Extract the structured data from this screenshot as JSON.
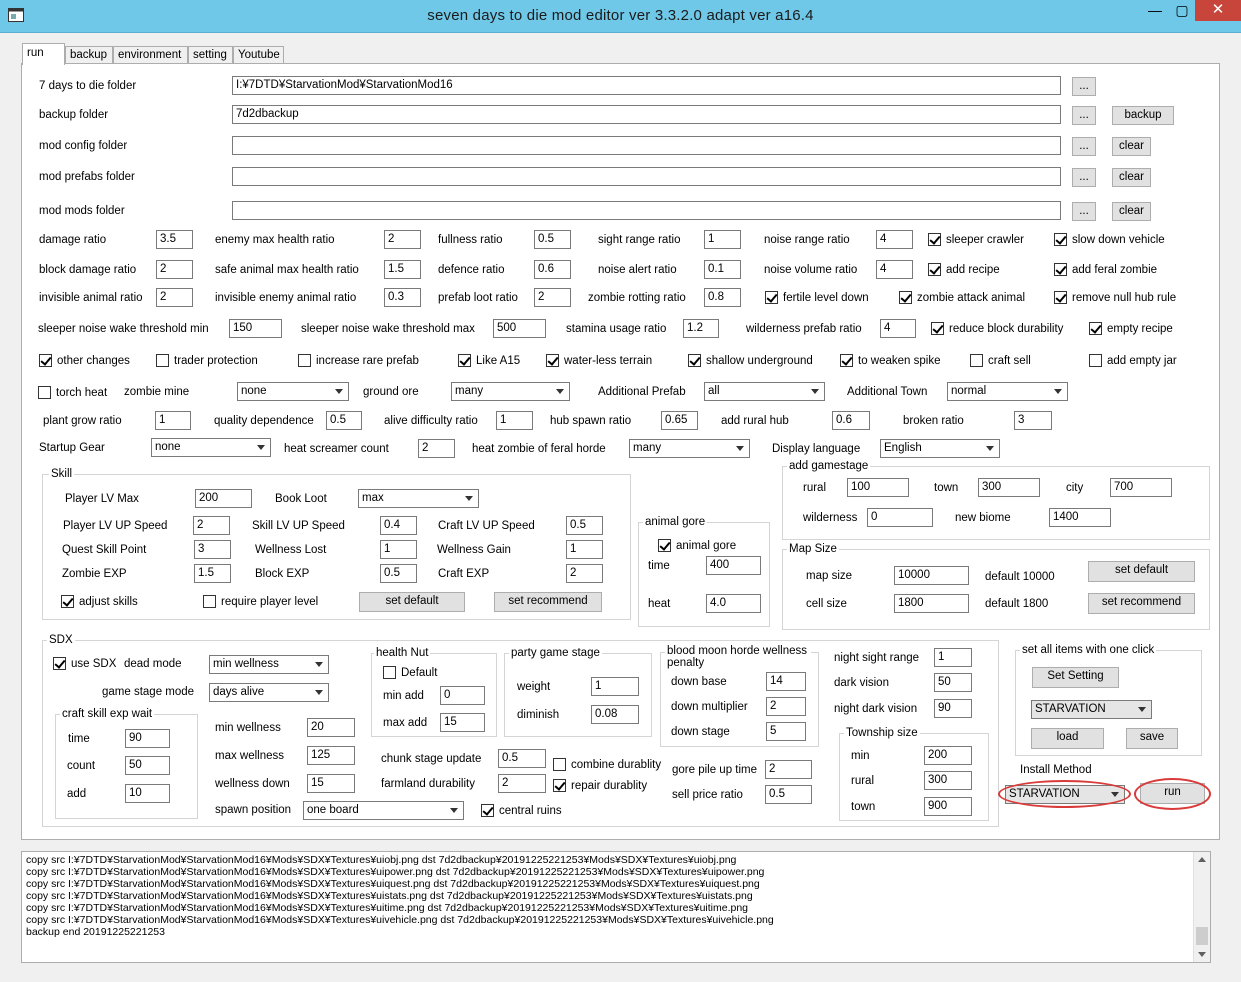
{
  "window": {
    "title": "seven days to die mod editor ver 3.3.2.0 adapt ver a16.4",
    "min": "—",
    "max": "▢",
    "close": "✕"
  },
  "tabs": [
    "run",
    "backup",
    "environment",
    "setting",
    "Youtube"
  ],
  "folders": {
    "seven_days_label": "7 days to die folder",
    "seven_days_value": "I:¥7DTD¥StarvationMod¥StarvationMod16",
    "backup_label": "backup folder",
    "backup_value": "7d2dbackup",
    "config_label": "mod config folder",
    "config_value": "",
    "prefabs_label": "mod prefabs folder",
    "prefabs_value": "",
    "mods_label": "mod mods folder",
    "mods_value": "",
    "browse": "...",
    "backup_btn": "backup",
    "clear_btn": "clear"
  },
  "row1": {
    "damage_ratio": "damage ratio",
    "damage_ratio_v": "3.5",
    "enemy_max_health_ratio": "enemy max health ratio",
    "enemy_max_health_ratio_v": "2",
    "fullness_ratio": "fullness ratio",
    "fullness_ratio_v": "0.5",
    "sight_range_ratio": "sight range ratio",
    "sight_range_ratio_v": "1",
    "noise_range_ratio": "noise range ratio",
    "noise_range_ratio_v": "4",
    "sleeper_crawler": "sleeper crawler",
    "slow_down_vehicle": "slow down vehicle"
  },
  "row2": {
    "block_damage_ratio": "block damage ratio",
    "block_damage_ratio_v": "2",
    "safe_animal": "safe animal max health ratio",
    "safe_animal_v": "1.5",
    "defence_ratio": "defence ratio",
    "defence_ratio_v": "0.6",
    "sight_alert_ratio": "noise alert ratio",
    "sight_alert_ratio_v": "0.1",
    "noise_volume_ratio": "noise volume ratio",
    "noise_volume_ratio_v": "4",
    "add_recipe": "add recipe",
    "add_feral_zombie": "add feral zombie"
  },
  "row3": {
    "invisible_animal_ratio": "invisible animal ratio",
    "invisible_animal_ratio_v": "2",
    "invisible_enemy": "invisible enemy animal ratio",
    "invisible_enemy_v": "0.3",
    "prefab_loot_ratio": "prefab loot ratio",
    "prefab_loot_ratio_v": "2",
    "zombie_rotting_ratio": "zombie rotting ratio",
    "zombie_rotting_ratio_v": "0.8",
    "fertile_level_down": "fertile level down",
    "zombie_attack_animal": "zombie attack animal",
    "remove_null_hub_rule": "remove null hub rule"
  },
  "row4": {
    "sleeper_min": "sleeper noise wake threshold min",
    "sleeper_min_v": "150",
    "sleeper_max": "sleeper noise wake threshold max",
    "sleeper_max_v": "500",
    "stamina": "stamina usage ratio",
    "stamina_v": "1.2",
    "wilderness": "wilderness prefab ratio",
    "wilderness_v": "4",
    "reduce_block_durability": "reduce block durability",
    "empty_recipe": "empty recipe"
  },
  "row5": {
    "other_changes": "other changes",
    "trader_protection": "trader protection",
    "increase_rare_prefab": "increase rare prefab",
    "like_a15": "Like A15",
    "water_less_terrain": "water-less terrain",
    "shallow_underground": "shallow underground",
    "to_weaken_spike": "to weaken spike",
    "craft_sell": "craft sell",
    "add_empty_jar": "add empty jar"
  },
  "row6": {
    "torch_heat": "torch heat",
    "zombie_mine": "zombie mine",
    "zombie_mine_v": "none",
    "ground_ore": "ground ore",
    "ground_ore_v": "many",
    "additional_prefab": "Additional Prefab",
    "additional_prefab_v": "all",
    "additional_town": "Additional Town",
    "additional_town_v": "normal"
  },
  "row7": {
    "plant_grow_ratio": "plant grow ratio",
    "plant_grow_ratio_v": "1",
    "quality_dependence": "quality dependence",
    "quality_dependence_v": "0.5",
    "alive_difficulty_ratio": "alive difficulty ratio",
    "alive_difficulty_ratio_v": "1",
    "hub_spawn_ratio": "hub spawn ratio",
    "hub_spawn_ratio_v": "0.65",
    "add_rural_hub": "add rural hub",
    "add_rural_hub_v": "0.6",
    "broken_ratio": "broken ratio",
    "broken_ratio_v": "3"
  },
  "row8": {
    "startup_gear": "Startup Gear",
    "startup_gear_v": "none",
    "heat_screamer_count": "heat screamer count",
    "heat_screamer_count_v": "2",
    "heat_zombie": "heat zombie of feral horde",
    "heat_zombie_v": "many",
    "display_language": "Display language",
    "display_language_v": "English"
  },
  "skill": {
    "caption": "Skill",
    "player_lv_max": "Player LV Max",
    "player_lv_max_v": "200",
    "book_loot": "Book Loot",
    "book_loot_v": "max",
    "player_lv_up_speed": "Player LV UP Speed",
    "player_lv_up_speed_v": "2",
    "skill_lv_up_speed": "Skill LV UP Speed",
    "skill_lv_up_speed_v": "0.4",
    "craft_lv_up_speed": "Craft LV UP Speed",
    "craft_lv_up_speed_v": "0.5",
    "quest_skill_point": "Quest Skill Point",
    "quest_skill_point_v": "3",
    "wellness_lost": "Wellness Lost",
    "wellness_lost_v": "1",
    "wellness_gain": "Wellness Gain",
    "wellness_gain_v": "1",
    "zombie_exp": "Zombie EXP",
    "zombie_exp_v": "1.5",
    "block_exp": "Block EXP",
    "block_exp_v": "0.5",
    "craft_exp": "Craft EXP",
    "craft_exp_v": "2",
    "adjust_skills": "adjust skills",
    "require_player_level": "require player level",
    "set_default": "set default",
    "set_recommend": "set recommend"
  },
  "animal_gore": {
    "caption": "animal gore",
    "checkbox": "animal gore",
    "time": "time",
    "time_v": "400",
    "heat": "heat",
    "heat_v": "4.0"
  },
  "gamestage": {
    "caption": "add gamestage",
    "rural": "rural",
    "rural_v": "100",
    "town": "town",
    "town_v": "300",
    "city": "city",
    "city_v": "700",
    "wilderness": "wilderness",
    "wilderness_v": "0",
    "new_biome": "new biome",
    "new_biome_v": "1400"
  },
  "map_size": {
    "caption": "Map Size",
    "map_size": "map size",
    "map_size_v": "10000",
    "default_map": "default 10000",
    "cell_size": "cell size",
    "cell_size_v": "1800",
    "default_cell": "default 1800",
    "set_default": "set default",
    "set_recommend": "set recommend"
  },
  "sdx": {
    "caption": "SDX",
    "use_sdx": "use SDX",
    "dead_mode": "dead mode",
    "dead_mode_v": "min wellness",
    "game_stage_mode": "game stage mode",
    "game_stage_mode_v": "days alive",
    "craft_caption": "craft skill exp wait",
    "time": "time",
    "time_v": "90",
    "count": "count",
    "count_v": "50",
    "add": "add",
    "add_v": "10",
    "min_wellness": "min wellness",
    "min_wellness_v": "20",
    "max_wellness": "max wellness",
    "max_wellness_v": "125",
    "wellness_down": "wellness down",
    "wellness_down_v": "15",
    "spawn_position": "spawn position",
    "spawn_position_v": "one board",
    "central_ruins": "central ruins",
    "health_caption": "health Nut",
    "health_default": "Default",
    "min_add": "min add",
    "min_add_v": "0",
    "max_add": "max add",
    "max_add_v": "15",
    "party_caption": "party game stage",
    "weight": "weight",
    "weight_v": "1",
    "diminish": "diminish",
    "diminish_v": "0.08",
    "chunk_stage_update": "chunk stage update",
    "chunk_stage_update_v": "0.5",
    "farmland_durability": "farmland durability",
    "farmland_durability_v": "2",
    "combine_durability": "combine durablity",
    "repair_durability": "repair durablity",
    "blood_caption": "blood moon horde wellness penalty",
    "down_base": "down base",
    "down_base_v": "14",
    "down_multiplier": "down multiplier",
    "down_multiplier_v": "2",
    "down_stage": "down stage",
    "down_stage_v": "5",
    "gore_pile": "gore pile up time",
    "gore_pile_v": "2",
    "sell_price": "sell price ratio",
    "sell_price_v": "0.5",
    "night_sight_range": "night sight range",
    "night_sight_range_v": "1",
    "dark_vision": "dark vision",
    "dark_vision_v": "50",
    "night_dark_vision": "night dark vision",
    "night_dark_vision_v": "90",
    "township_caption": "Township size",
    "min": "min",
    "min_v": "200",
    "rural": "rural",
    "rural_v": "300",
    "town": "town",
    "town_v": "900"
  },
  "set_all": {
    "caption": "set all items with one click",
    "set_setting": "Set Setting",
    "preset_v": "STARVATION",
    "load": "load",
    "save": "save"
  },
  "install": {
    "label": "Install Method",
    "method_v": "STARVATION",
    "run": "run"
  },
  "log": [
    "copy src I:¥7DTD¥StarvationMod¥StarvationMod16¥Mods¥SDX¥Textures¥uiobj.png dst 7d2dbackup¥20191225221253¥Mods¥SDX¥Textures¥uiobj.png",
    "copy src I:¥7DTD¥StarvationMod¥StarvationMod16¥Mods¥SDX¥Textures¥uipower.png dst 7d2dbackup¥20191225221253¥Mods¥SDX¥Textures¥uipower.png",
    "copy src I:¥7DTD¥StarvationMod¥StarvationMod16¥Mods¥SDX¥Textures¥uiquest.png dst 7d2dbackup¥20191225221253¥Mods¥SDX¥Textures¥uiquest.png",
    "copy src I:¥7DTD¥StarvationMod¥StarvationMod16¥Mods¥SDX¥Textures¥uistats.png dst 7d2dbackup¥20191225221253¥Mods¥SDX¥Textures¥uistats.png",
    "copy src I:¥7DTD¥StarvationMod¥StarvationMod16¥Mods¥SDX¥Textures¥uitime.png dst 7d2dbackup¥20191225221253¥Mods¥SDX¥Textures¥uitime.png",
    "copy src I:¥7DTD¥StarvationMod¥StarvationMod16¥Mods¥SDX¥Textures¥uivehicle.png dst 7d2dbackup¥20191225221253¥Mods¥SDX¥Textures¥uivehicle.png",
    "backup end 20191225221253"
  ]
}
